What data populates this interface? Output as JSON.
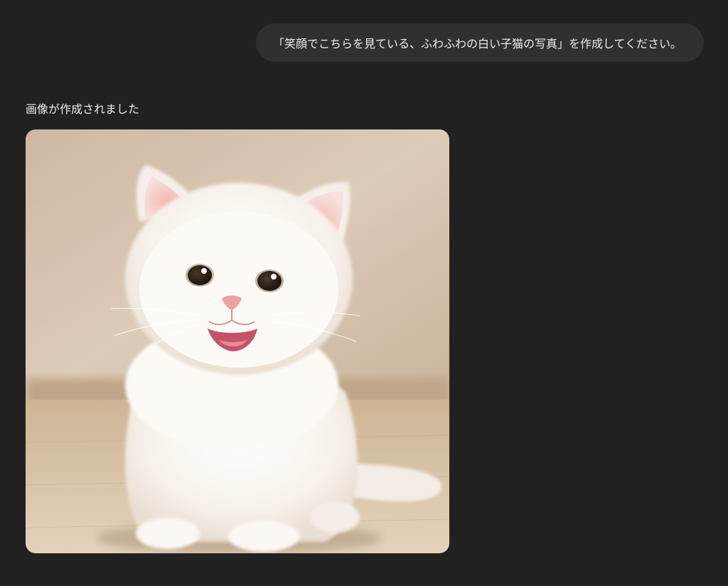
{
  "conversation": {
    "user_message": "「笑顔でこちらを見ている、ふわふわの白い子猫の写真」を作成してください。",
    "assistant_status": "画像が作成されました"
  },
  "generated_image": {
    "subject": "smiling fluffy white kitten",
    "colors": {
      "wall": "#d8c6b2",
      "floor": "#d9c4a8",
      "fur": "#fbf7f2",
      "eyes": "#2c2016",
      "nose": "#e9a3a3",
      "mouth": "#c9536a"
    }
  }
}
